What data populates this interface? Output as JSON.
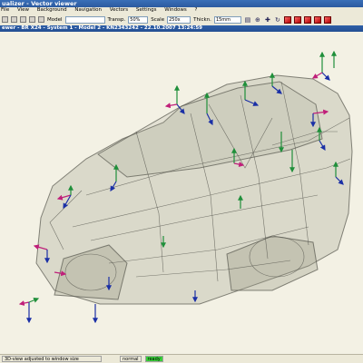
{
  "window": {
    "title": "ualizer - Vector viewer"
  },
  "menu": {
    "items": [
      "File",
      "View",
      "Background",
      "Navigation",
      "Vectors",
      "Settings",
      "Windows",
      "?"
    ]
  },
  "toolbar": {
    "model_label": "Model",
    "transp_label": "Transp.",
    "transp_value": "50%",
    "scale_label": "Scale",
    "scale_value": "250x",
    "thickn_label": "Thickn.",
    "thickn_value": "15mm"
  },
  "view": {
    "title": "ewer - BR X24 - System 1 - Model 2 - KN2343242 - 22.10.2007 13:24:59"
  },
  "status": {
    "message": "3D-view adjusted to window size",
    "mode": "normal",
    "state": "ready"
  },
  "colors": {
    "x_axis": "#c01f7a",
    "y_axis": "#1a2fa6",
    "z_axis": "#1f8f3a",
    "background": "#f3f1e4",
    "ready": "#38d138"
  }
}
